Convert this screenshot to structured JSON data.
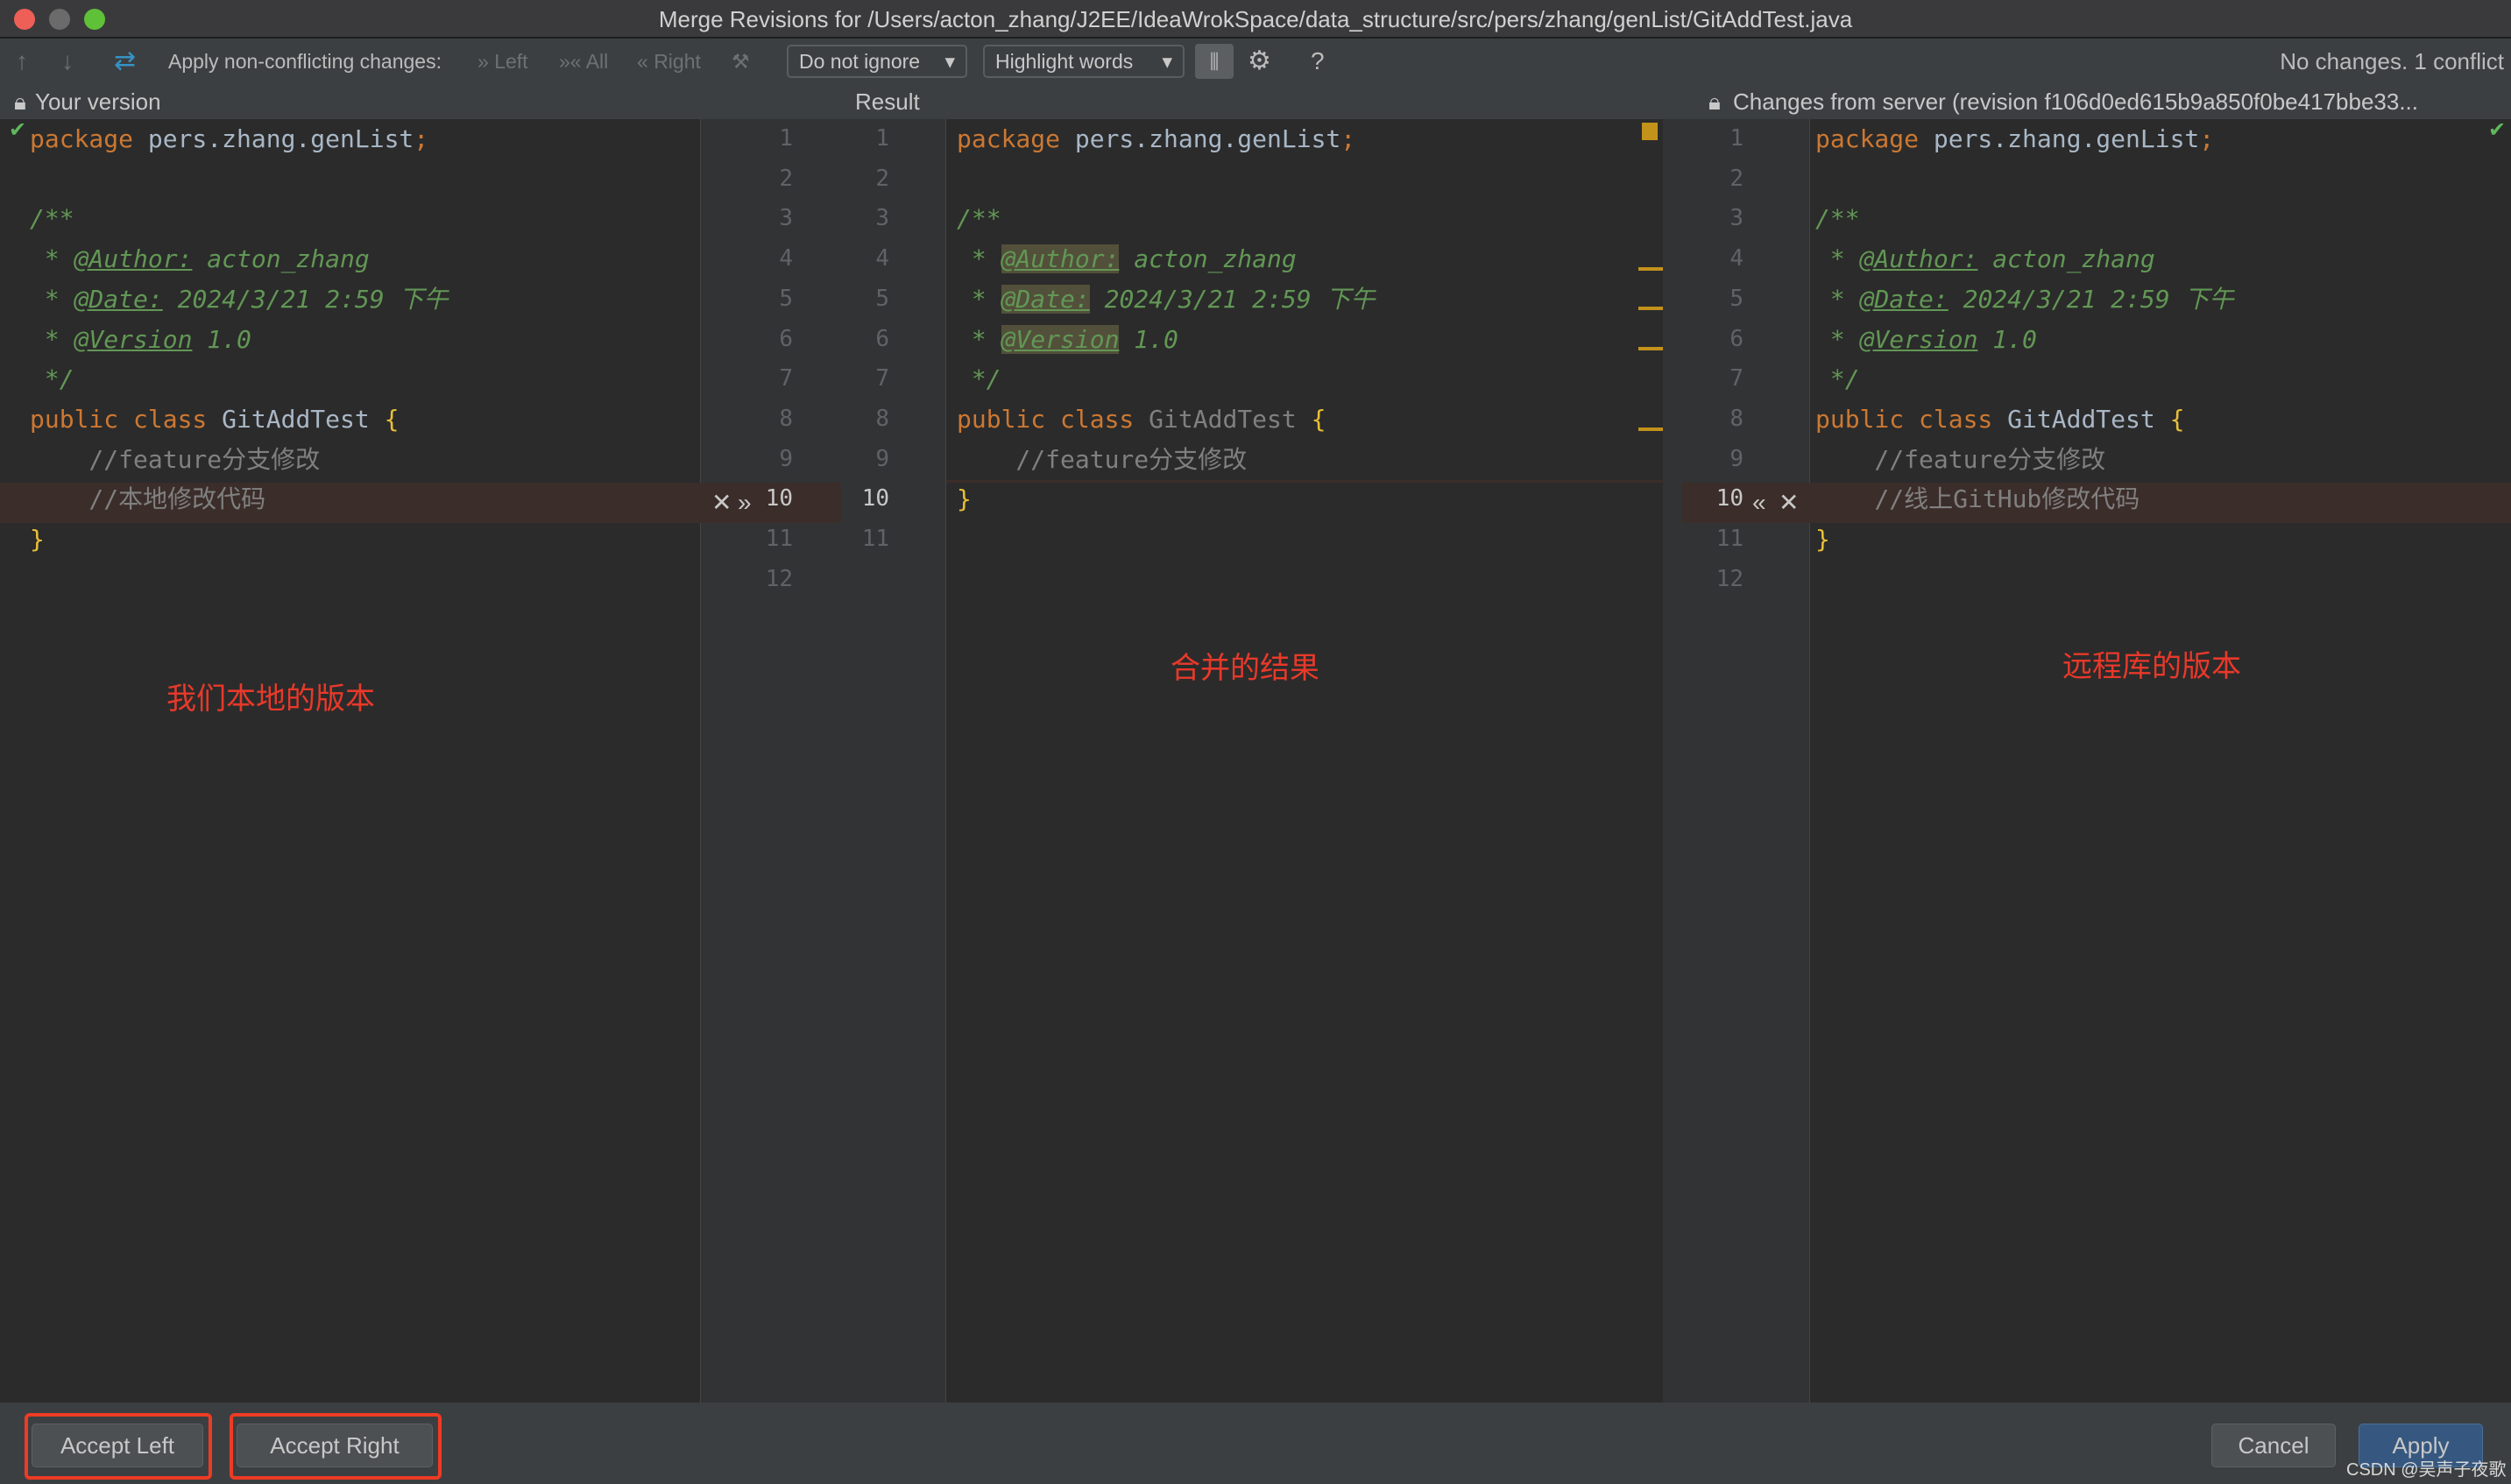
{
  "window": {
    "title": "Merge Revisions for /Users/acton_zhang/J2EE/IdeaWrokSpace/data_structure/src/pers/zhang/genList/GitAddTest.java"
  },
  "toolbar": {
    "apply_label": "Apply non-conflicting changes:",
    "left": "Left",
    "all": "All",
    "right": "Right",
    "ignore_select": "Do not ignore",
    "highlight_select": "Highlight words",
    "help": "?",
    "status": "No changes. 1 conflict"
  },
  "headers": {
    "left": "Your version",
    "center": "Result",
    "right": "Changes from server (revision f106d0ed615b9a850f0be417bbe33..."
  },
  "left": {
    "lines": [
      [
        [
          "package ",
          "kw"
        ],
        [
          "pers.zhang.genList",
          "plain"
        ],
        [
          ";",
          "kw"
        ]
      ],
      [],
      [
        [
          "/**",
          "doc"
        ]
      ],
      [
        [
          " * ",
          "doc"
        ],
        [
          "@Author:",
          "tag"
        ],
        [
          " acton_zhang",
          "doc"
        ]
      ],
      [
        [
          " * ",
          "doc"
        ],
        [
          "@Date:",
          "tag"
        ],
        [
          " 2024/3/21 2:59 下午",
          "doc"
        ]
      ],
      [
        [
          " * ",
          "doc"
        ],
        [
          "@Version",
          "tag"
        ],
        [
          " 1.0",
          "doc"
        ]
      ],
      [
        [
          " */",
          "doc"
        ]
      ],
      [
        [
          "public class ",
          "kw"
        ],
        [
          "GitAddTest ",
          "plain"
        ],
        [
          "{",
          "brace"
        ]
      ],
      [
        [
          "    //feature分支修改",
          "comment"
        ]
      ],
      [
        [
          "    //本地修改代码",
          "comment"
        ]
      ],
      [
        [
          "}",
          "brace"
        ]
      ]
    ]
  },
  "center": {
    "lines": [
      [
        [
          "package ",
          "kw"
        ],
        [
          "pers.zhang.genList",
          "plain"
        ],
        [
          ";",
          "kw"
        ]
      ],
      [],
      [
        [
          "/**",
          "doc"
        ]
      ],
      [
        [
          " * ",
          "doc"
        ],
        [
          "@Author:",
          "tag"
        ],
        [
          " acton_zhang",
          "doc"
        ]
      ],
      [
        [
          " * ",
          "doc"
        ],
        [
          "@Date:",
          "tag"
        ],
        [
          " 2024/3/21 2:59 下午",
          "doc"
        ]
      ],
      [
        [
          " * ",
          "doc"
        ],
        [
          "@Version",
          "tag"
        ],
        [
          " 1.0",
          "doc"
        ]
      ],
      [
        [
          " */",
          "doc"
        ]
      ],
      [
        [
          "public class ",
          "kw"
        ],
        [
          "GitAddTest ",
          "cls"
        ],
        [
          "{",
          "brace"
        ]
      ],
      [
        [
          "    //feature分支修改",
          "comment"
        ]
      ],
      [
        [
          "}",
          "brace"
        ]
      ]
    ]
  },
  "right": {
    "lines": [
      [
        [
          "package ",
          "kw"
        ],
        [
          "pers.zhang.genList",
          "plain"
        ],
        [
          ";",
          "kw"
        ]
      ],
      [],
      [
        [
          "/**",
          "doc"
        ]
      ],
      [
        [
          " * ",
          "doc"
        ],
        [
          "@Author:",
          "tag"
        ],
        [
          " acton_zhang",
          "doc"
        ]
      ],
      [
        [
          " * ",
          "doc"
        ],
        [
          "@Date:",
          "tag"
        ],
        [
          " 2024/3/21 2:59 下午",
          "doc"
        ]
      ],
      [
        [
          " * ",
          "doc"
        ],
        [
          "@Version",
          "tag"
        ],
        [
          " 1.0",
          "doc"
        ]
      ],
      [
        [
          " */",
          "doc"
        ]
      ],
      [
        [
          "public class ",
          "kw"
        ],
        [
          "GitAddTest ",
          "plain"
        ],
        [
          "{",
          "brace"
        ]
      ],
      [
        [
          "    //feature分支修改",
          "comment"
        ]
      ],
      [
        [
          "    //线上GitHub修改代码",
          "comment"
        ]
      ],
      [
        [
          "}",
          "brace"
        ]
      ]
    ]
  },
  "gutters": {
    "left": [
      "1",
      "2",
      "3",
      "4",
      "5",
      "6",
      "7",
      "8",
      "9",
      "10",
      "11",
      "12"
    ],
    "result": [
      "1",
      "2",
      "3",
      "4",
      "5",
      "6",
      "7",
      "8",
      "9",
      "10",
      "11"
    ],
    "right": [
      "1",
      "2",
      "3",
      "4",
      "5",
      "6",
      "7",
      "8",
      "9",
      "10",
      "11",
      "12"
    ]
  },
  "annotations": {
    "left": "我们本地的版本",
    "center": "合并的结果",
    "right": "远程库的版本"
  },
  "footer": {
    "accept_left": "Accept Left",
    "accept_right": "Accept Right",
    "cancel": "Cancel",
    "apply": "Apply",
    "watermark": "CSDN @吴声子夜歌"
  },
  "colors": {
    "accent": "#365880",
    "conflict": "#3b2d2a",
    "annotation": "#e8392a"
  }
}
